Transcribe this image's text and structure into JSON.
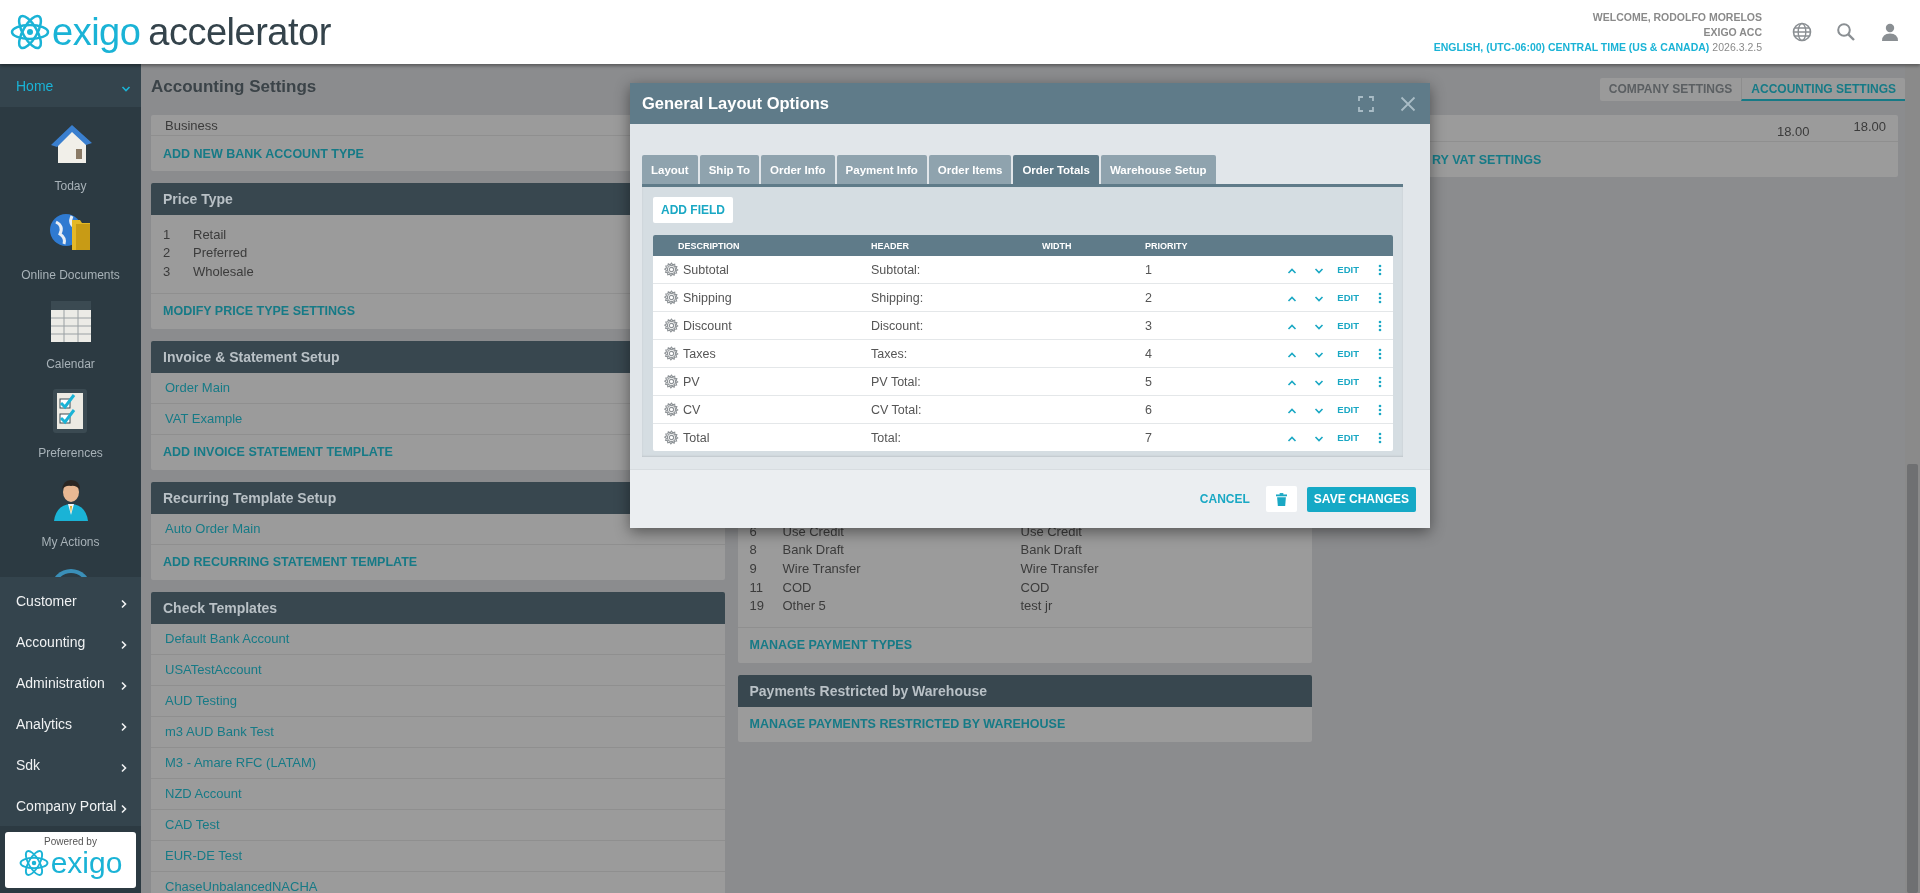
{
  "header": {
    "logo": {
      "brand": "exigo",
      "product": "accelerator"
    },
    "welcome": "WELCOME, RODOLFO MORELOS",
    "company": "EXIGO ACC",
    "locale": "ENGLISH, (UTC-06:00) CENTRAL TIME (US & CANADA)",
    "version": "2026.3.2.5"
  },
  "sidebar": {
    "home": {
      "label": "Home",
      "expanded": true
    },
    "apps": [
      {
        "kind": "house",
        "label": "Today"
      },
      {
        "kind": "globe-folder",
        "label": "Online Documents"
      },
      {
        "kind": "calendar",
        "label": "Calendar"
      },
      {
        "kind": "checklist",
        "label": "Preferences"
      },
      {
        "kind": "person",
        "label": "My Actions"
      },
      {
        "kind": "circle"
      }
    ],
    "menu": [
      {
        "label": "Customer",
        "expanded": false
      },
      {
        "label": "Accounting",
        "expanded": false
      },
      {
        "label": "Administration",
        "expanded": false
      },
      {
        "label": "Analytics",
        "expanded": false
      },
      {
        "label": "Sdk",
        "expanded": false
      },
      {
        "label": "Company Portal",
        "expanded": false
      }
    ],
    "powered": {
      "caption": "Powered by",
      "brand": "exigo"
    }
  },
  "page": {
    "title": "Accounting Settings",
    "settings_tabs": [
      {
        "label": "COMPANY SETTINGS",
        "selected": false
      },
      {
        "label": "ACCOUNTING SETTINGS",
        "selected": true
      }
    ],
    "left_column": [
      {
        "lines": [
          {
            "kind": "text",
            "text": "Business"
          }
        ],
        "action": "ADD NEW BANK ACCOUNT TYPE"
      },
      {
        "title": "Price Type",
        "lines": [
          {
            "kind": "numbered",
            "number": "1",
            "text": "Retail"
          },
          {
            "kind": "numbered",
            "number": "2",
            "text": "Preferred"
          },
          {
            "kind": "numbered",
            "number": "3",
            "text": "Wholesale"
          }
        ],
        "action": "MODIFY PRICE TYPE SETTINGS"
      },
      {
        "title": "Invoice & Statement Setup",
        "lines": [
          {
            "kind": "link",
            "text": "Order Main"
          },
          {
            "kind": "link",
            "text": "VAT Example"
          }
        ],
        "action": "ADD INVOICE STATEMENT TEMPLATE"
      },
      {
        "title": "Recurring Template Setup",
        "lines": [
          {
            "kind": "link",
            "text": "Auto Order Main"
          }
        ],
        "action": "ADD RECURRING STATEMENT TEMPLATE"
      },
      {
        "title": "Check Templates",
        "lines": [
          {
            "kind": "link",
            "text": "Default Bank Account"
          },
          {
            "kind": "link",
            "text": "USATestAccount"
          },
          {
            "kind": "link",
            "text": "AUD Testing"
          },
          {
            "kind": "link",
            "text": "m3 AUD Bank Test"
          },
          {
            "kind": "link",
            "text": "M3 - Amare RFC (LATAM)"
          },
          {
            "kind": "link",
            "text": "NZD Account"
          },
          {
            "kind": "link",
            "text": "CAD Test"
          },
          {
            "kind": "link",
            "text": "EUR-DE Test"
          },
          {
            "kind": "link",
            "text": "ChaseUnbalancedNACHA"
          }
        ]
      }
    ],
    "middle_column": [
      {
        "lines": [
          {
            "kind": "payment",
            "number": "6",
            "text": "Use Credit",
            "display": "Use Credit"
          },
          {
            "kind": "payment",
            "number": "8",
            "text": "Bank Draft",
            "display": "Bank Draft"
          },
          {
            "kind": "payment",
            "number": "9",
            "text": "Wire Transfer",
            "display": "Wire Transfer"
          },
          {
            "kind": "payment",
            "number": "11",
            "text": "COD",
            "display": "COD"
          },
          {
            "kind": "payment",
            "number": "19",
            "text": "Other 5",
            "display": "test jr"
          }
        ],
        "action": "MANAGE PAYMENT TYPES"
      },
      {
        "title": "Payments Restricted by Warehouse",
        "action": "MANAGE PAYMENTS RESTRICTED BY WAREHOUSE"
      }
    ],
    "right_column": {
      "values": [
        "18.00",
        "18.00"
      ],
      "action": "RY VAT SETTINGS"
    }
  },
  "modal": {
    "title": "General Layout Options",
    "tabs": [
      {
        "label": "Layout",
        "selected": false
      },
      {
        "label": "Ship To",
        "selected": false
      },
      {
        "label": "Order Info",
        "selected": false
      },
      {
        "label": "Payment Info",
        "selected": false
      },
      {
        "label": "Order Items",
        "selected": false
      },
      {
        "label": "Order Totals",
        "selected": true
      },
      {
        "label": "Warehouse Setup",
        "selected": false
      }
    ],
    "add_field": "ADD FIELD",
    "table": {
      "columns": [
        "DESCRIPTION",
        "HEADER",
        "WIDTH",
        "PRIORITY"
      ],
      "rows": [
        {
          "description": "Subtotal",
          "header": "Subtotal:",
          "priority": "1",
          "action": "EDIT"
        },
        {
          "description": "Shipping",
          "header": "Shipping:",
          "priority": "2",
          "action": "EDIT"
        },
        {
          "description": "Discount",
          "header": "Discount:",
          "priority": "3",
          "action": "EDIT"
        },
        {
          "description": "Taxes",
          "header": "Taxes:",
          "priority": "4",
          "action": "EDIT"
        },
        {
          "description": "PV",
          "header": "PV Total:",
          "priority": "5",
          "action": "EDIT"
        },
        {
          "description": "CV",
          "header": "CV Total:",
          "priority": "6",
          "action": "EDIT"
        },
        {
          "description": "Total",
          "header": "Total:",
          "priority": "7",
          "action": "EDIT"
        }
      ]
    },
    "cancel": "CANCEL",
    "save": "SAVE CHANGES"
  }
}
